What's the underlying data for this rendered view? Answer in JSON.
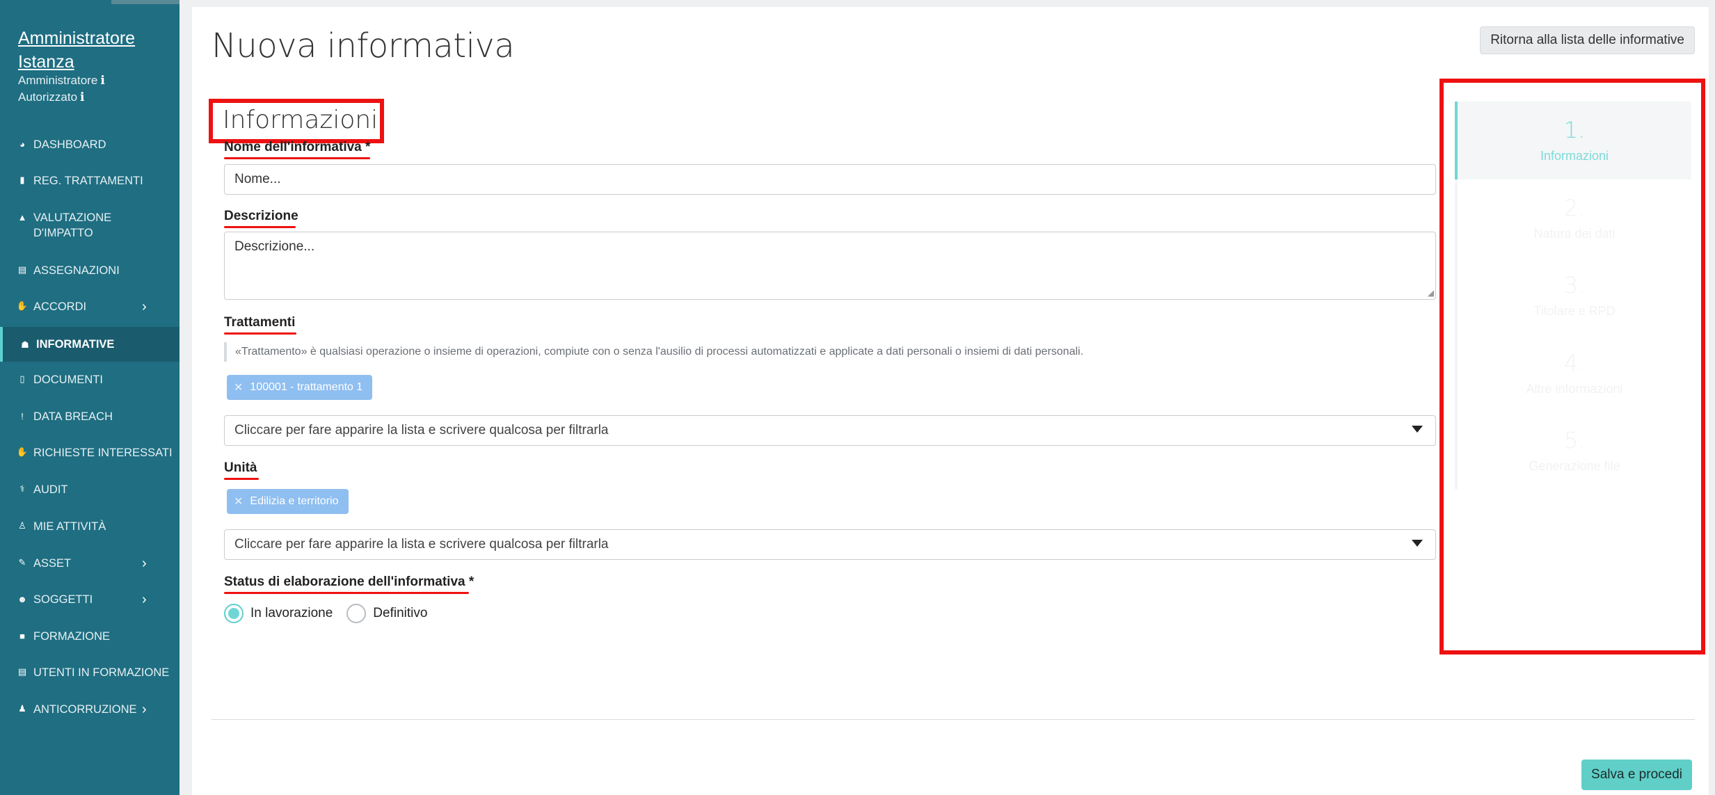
{
  "user": {
    "name": "Amministratore Istanza",
    "role": "Amministratore",
    "status": "Autorizzato"
  },
  "sidebar": {
    "items": [
      {
        "label": "DASHBOARD",
        "icon": "gauge-icon"
      },
      {
        "label": "REG. TRATTAMENTI",
        "icon": "book-icon"
      },
      {
        "label": "VALUTAZIONE D'IMPATTO",
        "icon": "warning-icon"
      },
      {
        "label": "ASSEGNAZIONI",
        "icon": "address-book-icon"
      },
      {
        "label": "ACCORDI",
        "icon": "handshake-icon"
      },
      {
        "label": "INFORMATIVE",
        "icon": "sitemap-icon"
      },
      {
        "label": "DOCUMENTI",
        "icon": "file-icon"
      },
      {
        "label": "DATA BREACH",
        "icon": "exclamation-icon"
      },
      {
        "label": "RICHIESTE INTERESSATI",
        "icon": "hand-icon"
      },
      {
        "label": "AUDIT",
        "icon": "stethoscope-icon"
      },
      {
        "label": "MIE ATTIVITÀ",
        "icon": "person-icon"
      },
      {
        "label": "ASSET",
        "icon": "edit-icon"
      },
      {
        "label": "SOGGETTI",
        "icon": "users-icon"
      },
      {
        "label": "FORMAZIONE",
        "icon": "video-icon"
      },
      {
        "label": "UTENTI IN FORMAZIONE",
        "icon": "list-icon"
      },
      {
        "label": "ANTICORRUZIONE",
        "icon": "user-shield-icon"
      }
    ]
  },
  "header": {
    "title": "Nuova informativa",
    "back_button": "Ritorna alla lista delle informative"
  },
  "form": {
    "section_title": "Informazioni",
    "name_label": "Nome dell'informativa *",
    "name_placeholder": "Nome...",
    "description_label": "Descrizione",
    "description_placeholder": "Descrizione...",
    "treatments_label": "Trattamenti",
    "treatments_hint": "«Trattamento» è qualsiasi operazione o insieme di operazioni, compiute con o senza l'ausilio di processi automatizzati e applicate a dati personali o insiemi di dati personali.",
    "treatments_tag": "100001 - trattamento 1",
    "treatments_select_placeholder": "Cliccare per fare apparire la lista e scrivere qualcosa per filtrarla",
    "units_label": "Unità",
    "units_tag": "Edilizia e territorio",
    "units_select_placeholder": "Cliccare per fare apparire la lista e scrivere qualcosa per filtrarla",
    "status_label": "Status di elaborazione dell'informativa *",
    "status_options": [
      "In lavorazione",
      "Definitivo"
    ],
    "status_selected": "In lavorazione",
    "tag_remove_symbol": "✕"
  },
  "footer": {
    "save_button": "Salva e procedi"
  },
  "steps": [
    {
      "number": "1.",
      "name": "Informazioni"
    },
    {
      "number": "2.",
      "name": "Natura dei dati"
    },
    {
      "number": "3.",
      "name": "Titolare e RPD"
    },
    {
      "number": "4.",
      "name": "Altre informazioni"
    },
    {
      "number": "5.",
      "name": "Generazione file"
    }
  ],
  "colors": {
    "sidebar": "#1f6e82",
    "accent": "#5fcfc8",
    "highlight_box": "#ee1111",
    "tag": "#8fbef0"
  }
}
